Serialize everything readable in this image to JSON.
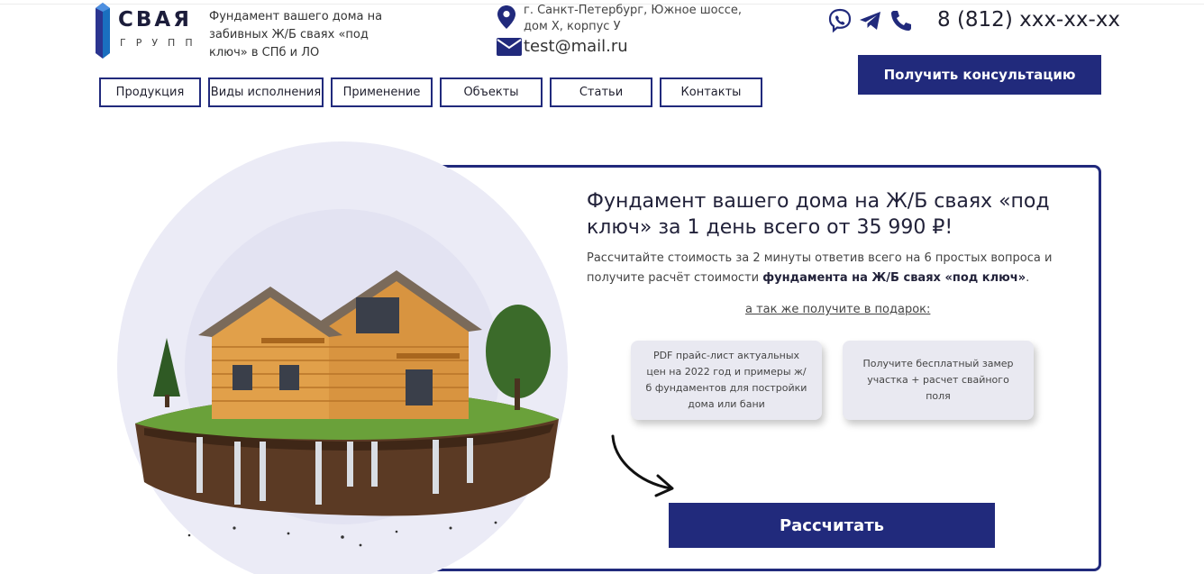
{
  "header": {
    "logo": {
      "word": "СВАЯ",
      "sub": "ГРУПП"
    },
    "tagline": "Фундамент вашего дома на забивных Ж/Б сваях «под ключ» в СПб и ЛО",
    "address": "г. Санкт-Петербург, Южное шоссе, дом Х, корпус У",
    "email": "test@mail.ru",
    "phone": "8 (812) xxx-xx-xx",
    "messenger_icons": [
      "viber-icon",
      "telegram-icon",
      "phone-icon"
    ],
    "consult_button": "Получить консультацию"
  },
  "nav": {
    "items": [
      {
        "label": "Продукция"
      },
      {
        "label": "Виды исполнения"
      },
      {
        "label": "Применение"
      },
      {
        "label": "Объекты"
      },
      {
        "label": "Статьи"
      },
      {
        "label": "Контакты"
      }
    ]
  },
  "hero": {
    "title": "Фундамент вашего дома на Ж/Б сваях «под ключ» за 1 день всего от 35 990 ₽!",
    "desc_prefix": "Рассчитайте стоимость за 2 минуты ответив всего на 6 простых вопроса и получите расчёт стоимости ",
    "desc_bold": "фундамента на Ж/Б сваях «под ключ»",
    "desc_suffix": ".",
    "gift_link": "а так же получите в подарок:",
    "gifts": [
      {
        "text": "PDF прайс-лист актуальных цен на 2022 год и примеры ж/б фундаментов для постройки дома или бани"
      },
      {
        "text": "Получите бесплатный замер участка + расчет свайного поля"
      }
    ],
    "calc_button": "Рассчитать"
  },
  "colors": {
    "brand": "#212a7c",
    "circle": "#ebebf6",
    "card_bg": "#e9e9f1"
  }
}
